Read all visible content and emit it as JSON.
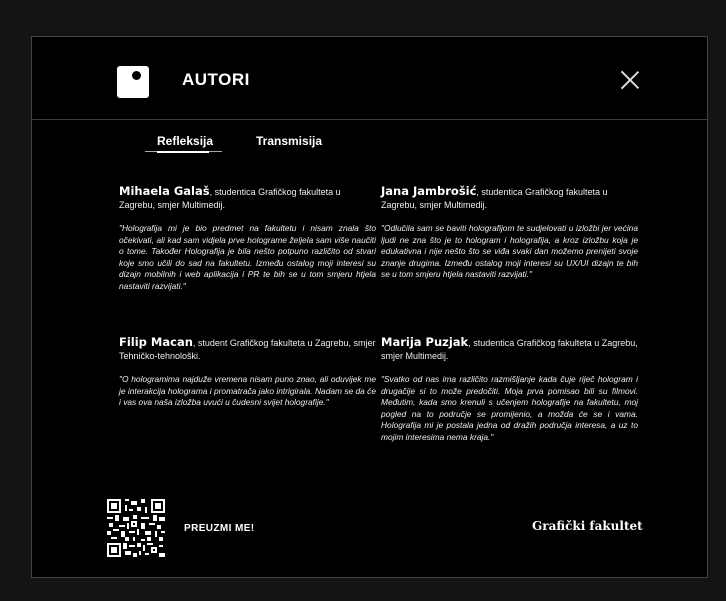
{
  "header": {
    "title": "AUTORI",
    "logo_icon": "square-logo-icon",
    "close_icon": "close-icon"
  },
  "tabs": [
    {
      "label": "Refleksija",
      "active": true
    },
    {
      "label": "Transmisija",
      "active": false
    }
  ],
  "authors": [
    {
      "name": "Mihaela Galaš",
      "bio": ", studentica Grafičkog fakulteta u Zagrebu, smjer Multimedij.",
      "quote": "\"Holografija mi je bio predmet na fakultetu i nisam znala što očekivati, ali kad sam vidjela prve holograme željela sam više naučiti o tome. Također Holografija je bila nešto potpuno različito od stvari koje smo učili do sad na fakultetu. Između ostalog moji interesi su dizajn mobilnih i web aplikacija i PR te bih se u tom smjeru htjela nastaviti razvijati.\""
    },
    {
      "name": "Jana Jambrošić",
      "bio": ", studentica Grafičkog fakulteta u Zagrebu, smjer Multimedij.",
      "quote": "\"Odlučila sam se baviti holografijom te sudjelovati u izložbi jer većina ljudi ne zna što je to hologram i holografija, a kroz izložbu koja je edukativna i nije nešto što se viđa svaki dan možemo prenijeti svoje znanje drugima. Između ostalog moji interesi su UX/UI dizajn te bih se u tom smjeru htjela nastaviti razvijati.\""
    },
    {
      "name": "Filip Macan",
      "bio": ", student Grafičkog fakulteta u Zagrebu, smjer Tehničko-tehnološki.",
      "quote": "\"O hologramima najduže vremena nisam puno znao, ali oduvijek me je interakcija holograma i promatrača jako intrigirala. Nadam se da će i vas ova naša izložba uvući u čudesni svijet holografije.\""
    },
    {
      "name": "Marija Puzjak",
      "bio": ", studentica Grafičkog fakulteta u Zagrebu, smjer Multimedij.",
      "quote": "\"Svatko od nas ima različito razmišljanje kada čuje riječ hologram i drugačije si to može predočiti. Moja prva pomisao bili su filmovi. Međutim, kada smo krenuli s učenjem holografije na fakultetu, moj pogled na to područje se promijenio, a možda će se i vama. Holografija mi je postala jedna od dražih područja interesa, a uz to mojim interesima nema kraja.\""
    }
  ],
  "footer": {
    "qr_icon": "qr-code-icon",
    "download_label": "PREUZMI ME!",
    "faculty": "Grafički fakultet"
  }
}
